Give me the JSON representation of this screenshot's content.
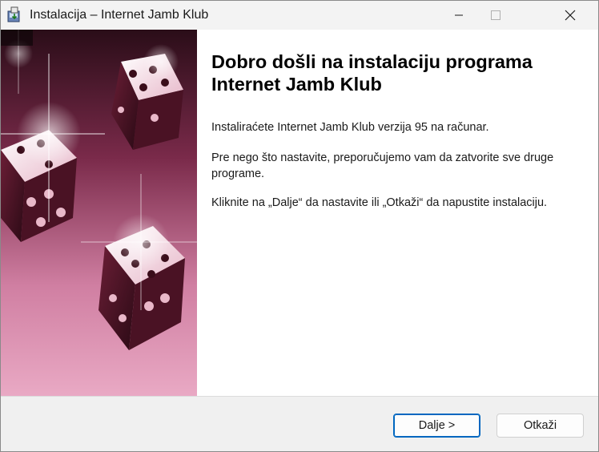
{
  "window": {
    "title": "Instalacija – Internet Jamb Klub"
  },
  "titlebar_buttons": {
    "minimize_icon": "minimize-icon",
    "maximize_icon": "maximize-icon",
    "close_icon": "close-icon"
  },
  "content": {
    "heading": "Dobro došli na instalaciju programa Internet Jamb Klub",
    "paragraph1": "Instaliraćete Internet Jamb Klub verzija 95 na računar.",
    "paragraph2": "Pre nego što nastavite, preporučujemo vam da zatvorite sve druge programe.",
    "paragraph3": "Kliknite na „Dalje“ da nastavite ili „Otkaži“ da napustite instalaciju."
  },
  "buttons": {
    "next_label": "Dalje >",
    "cancel_label": "Otkaži"
  },
  "colors": {
    "banner_pink": "#c86790",
    "accent_blue": "#0067c0"
  }
}
